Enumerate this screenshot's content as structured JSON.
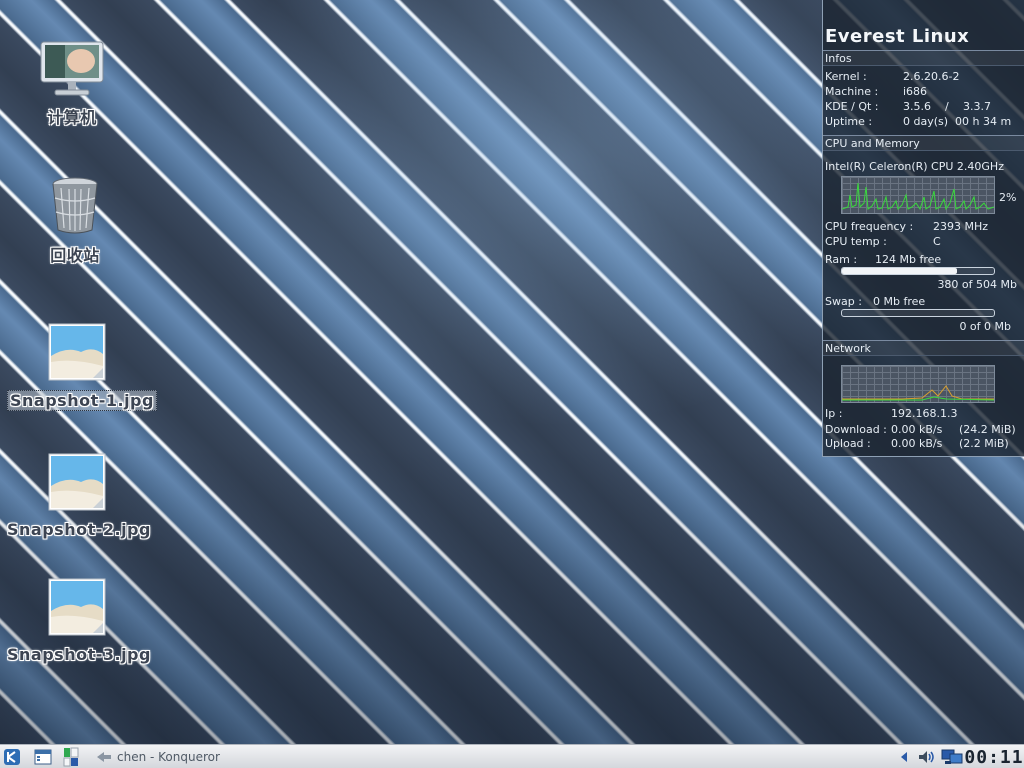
{
  "desktop": {
    "icons": [
      {
        "label": "计算机",
        "icon": "computer-monitor-icon"
      },
      {
        "label": "回收站",
        "icon": "trash-bin-icon"
      },
      {
        "label": "Snapshot-1.jpg",
        "icon": "image-file-icon",
        "selected": true
      },
      {
        "label": "Snapshot-2.jpg",
        "icon": "image-file-icon"
      },
      {
        "label": "Snapshot-3.jpg",
        "icon": "image-file-icon"
      }
    ]
  },
  "monitor": {
    "title": "Everest Linux",
    "infos": {
      "header": "Infos",
      "kernel_label": "Kernel :",
      "kernel_value": "2.6.20.6-2",
      "machine_label": "Machine :",
      "machine_value": "i686",
      "kde_label": "KDE / Qt :",
      "kde_value": "3.5.6",
      "kde_sep": "/",
      "qt_value": "3.3.7",
      "uptime_label": "Uptime :",
      "uptime_value": "0 day(s)  00 h 34 m"
    },
    "cpu": {
      "header": "CPU and Memory",
      "model": "Intel(R) Celeron(R) CPU 2.40GHz",
      "usage": "2%",
      "freq_label": "CPU frequency :",
      "freq_value": "2393 MHz",
      "temp_label": "CPU temp :",
      "temp_value": "C",
      "ram_label": "Ram :",
      "ram_free": "124 Mb free",
      "ram_used_fraction": 0.754,
      "ram_summary": "380 of 504 Mb",
      "swap_label": "Swap :",
      "swap_free": "0 Mb free",
      "swap_used_fraction": 0,
      "swap_summary": "0 of 0 Mb",
      "graph_color": "#39d93c"
    },
    "network": {
      "header": "Network",
      "ip_label": "Ip :",
      "ip_value": "192.168.1.3",
      "download_label": "Download :",
      "download_rate": "0.00 kB/s",
      "download_total": "(24.2 MiB)",
      "upload_label": "Upload :",
      "upload_rate": "0.00 kB/s",
      "upload_total": "(2.2 MiB)",
      "graph_color": "#d9a030"
    }
  },
  "taskbar": {
    "kmenu_icon": "kde-menu-icon",
    "desktop_icon": "show-desktop-icon",
    "pager_icon": "desktop-pager-icon",
    "task_icon": "konqueror-icon",
    "task_label": "chen - Konqueror",
    "tray": [
      "tray-arrow-icon",
      "volume-icon",
      "network-icon"
    ],
    "clock": "00:11"
  },
  "colors": {
    "accent": "#4a7fb5",
    "widget_bg": "#1c2632",
    "taskbar_bg": "#e2e4e8"
  }
}
